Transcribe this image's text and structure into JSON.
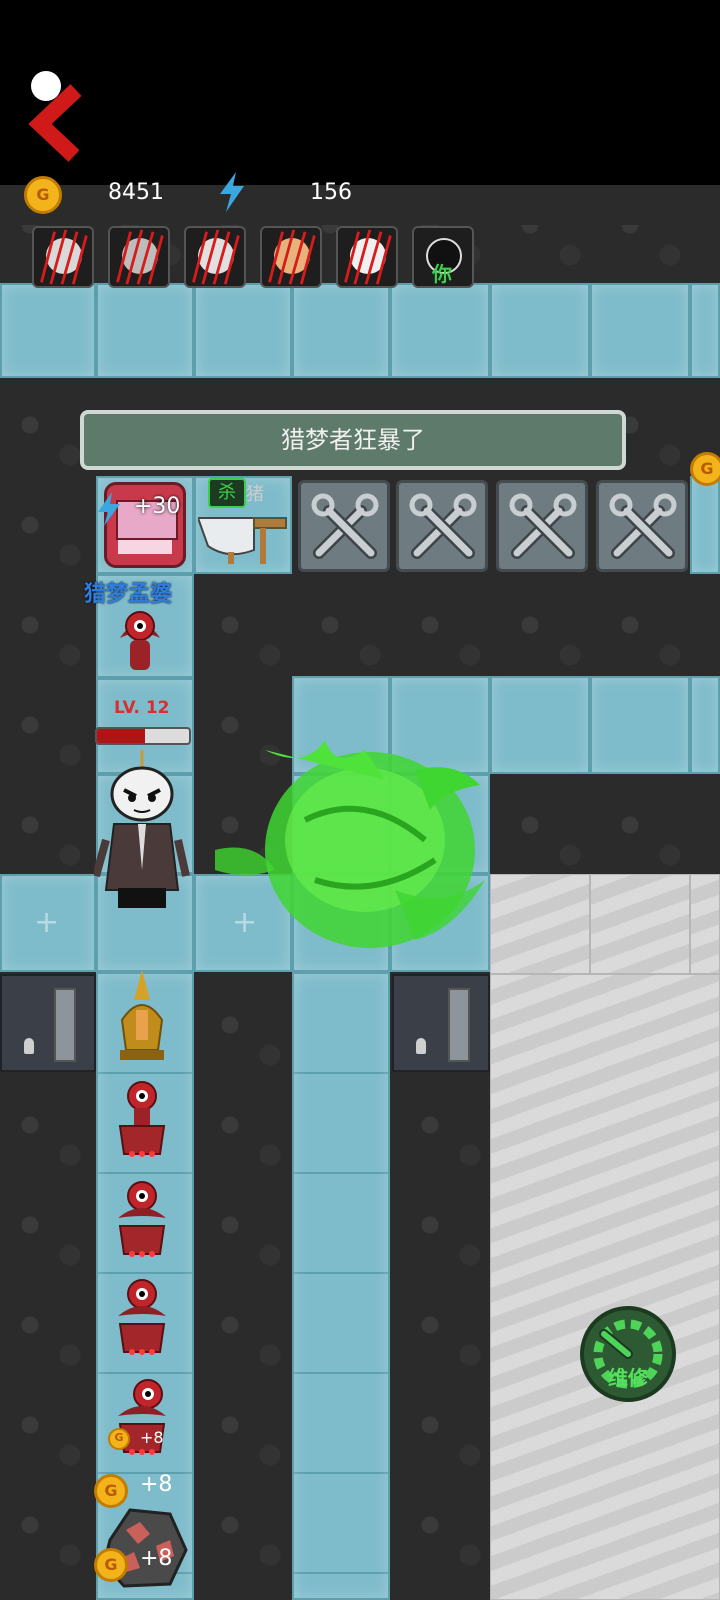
{
  "resources": {
    "gold": "8451",
    "energy": "156"
  },
  "players": [
    {
      "name": "player-1-eliminated"
    },
    {
      "name": "player-2-eliminated"
    },
    {
      "name": "player-3-eliminated"
    },
    {
      "name": "player-4-eliminated"
    },
    {
      "name": "player-5-eliminated"
    },
    {
      "name": "player-self",
      "label": "你"
    }
  ],
  "banner": {
    "text": "猎梦者狂暴了"
  },
  "machine": {
    "energy_gain": "+30"
  },
  "kill_tag": {
    "label": "杀",
    "suffix": "猪"
  },
  "hunter": {
    "name": "猎梦孟婆",
    "level": "LV. 12",
    "hp_fraction": 0.52
  },
  "gains": [
    "+8",
    "+8",
    "+8"
  ],
  "repair_button": {
    "label": "维修"
  },
  "colors": {
    "ice": "#7fbccb",
    "wall": "#2b2b2b",
    "accent_green": "#3bd04a",
    "hp_red": "#b11414"
  }
}
